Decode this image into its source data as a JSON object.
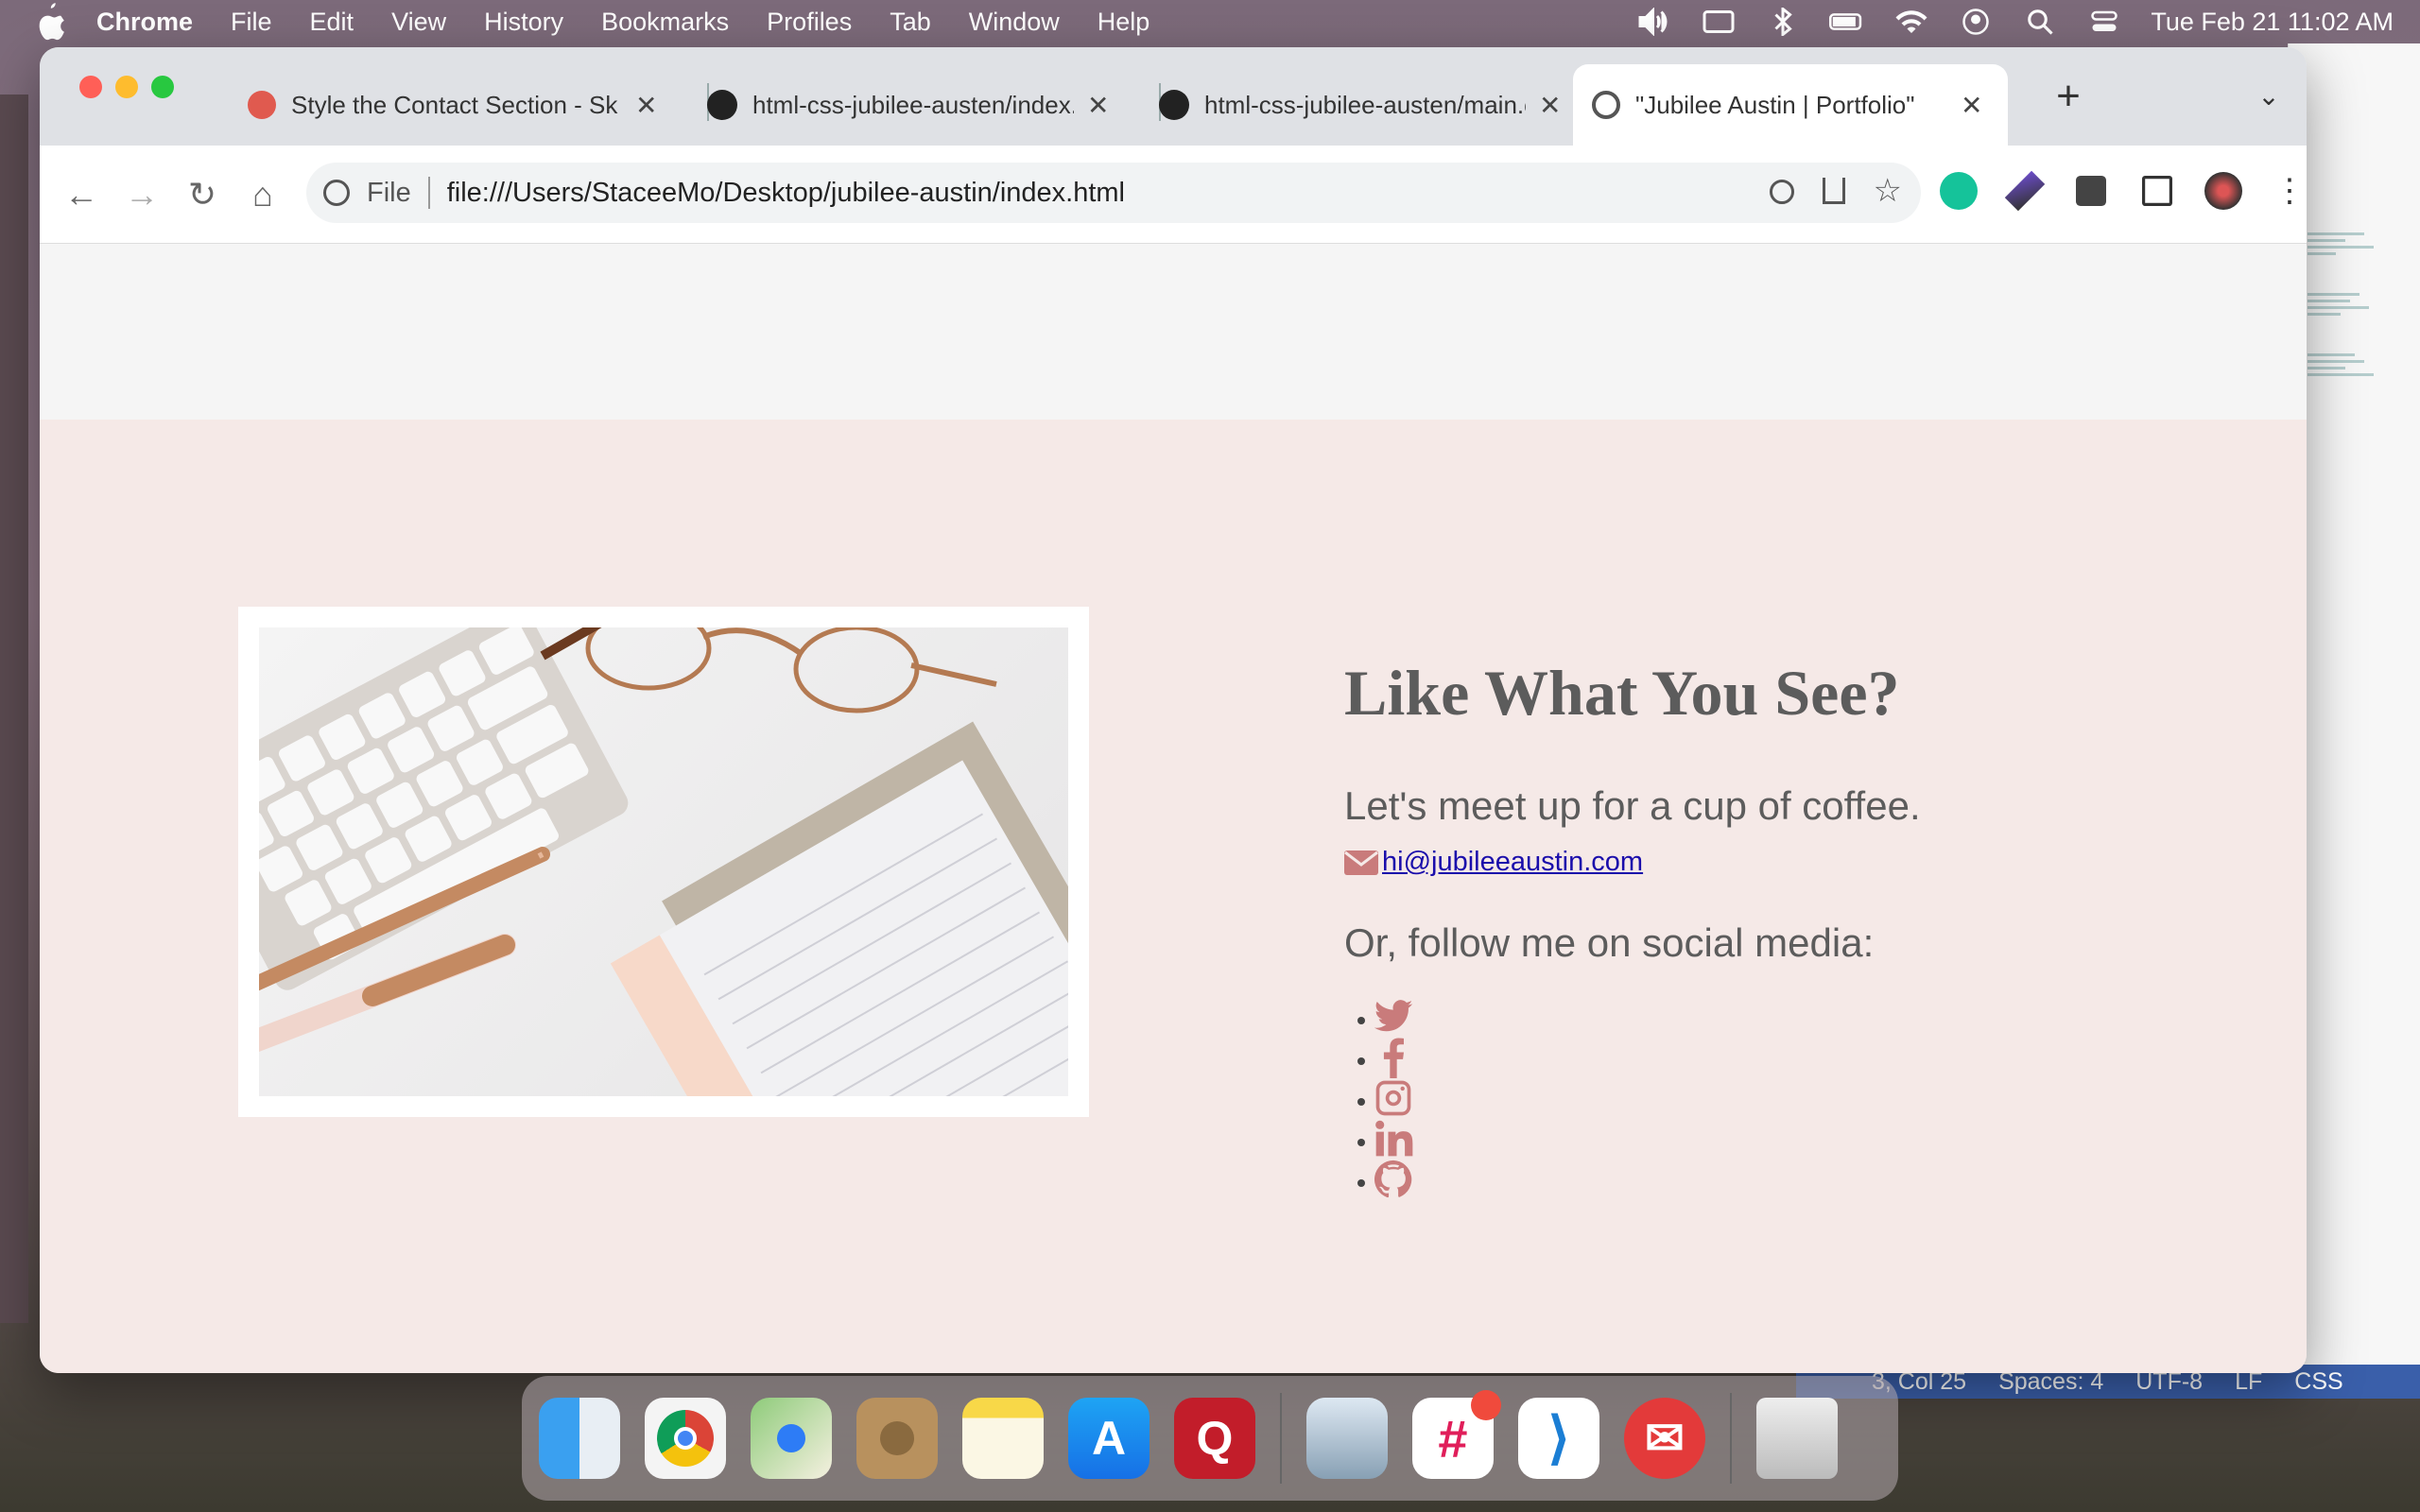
{
  "menubar": {
    "app": "Chrome",
    "items": [
      "File",
      "Edit",
      "View",
      "History",
      "Bookmarks",
      "Profiles",
      "Tab",
      "Window",
      "Help"
    ],
    "clock": "Tue Feb 21  11:02 AM"
  },
  "browser": {
    "tabs": [
      {
        "title": "Style the Contact Section - Sk",
        "active": false
      },
      {
        "title": "html-css-jubilee-austen/index.",
        "active": false
      },
      {
        "title": "html-css-jubilee-austen/main.c",
        "active": false
      },
      {
        "title": "\"Jubilee Austin | Portfolio\"",
        "active": true
      }
    ],
    "address": {
      "scheme_label": "File",
      "url": "file:///Users/StaceeMo/Desktop/jubilee-austin/index.html"
    }
  },
  "page": {
    "heading": "Like What You See?",
    "coffee_text": "Let's meet up for a cup of coffee.",
    "email": "hi@jubileeaustin.com",
    "social_text": "Or, follow me on social media:",
    "social_icons": [
      "twitter-icon",
      "facebook-icon",
      "instagram-icon",
      "linkedin-icon",
      "github-icon"
    ]
  },
  "editor_status": {
    "position": "3, Col 25",
    "spaces": "Spaces: 4",
    "encoding": "UTF-8",
    "eol": "LF",
    "lang": "CSS"
  },
  "colors": {
    "accent": "#c97b7b",
    "contact_bg": "#f5e9e7",
    "heading": "#5c5c5c",
    "link": "#1a0dab"
  }
}
